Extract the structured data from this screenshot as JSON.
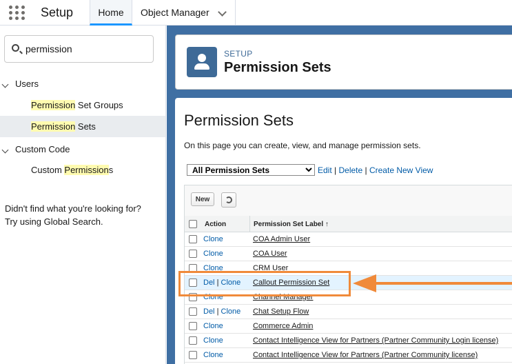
{
  "topbar": {
    "app_title": "Setup",
    "tabs": [
      {
        "label": "Home",
        "active": true
      },
      {
        "label": "Object Manager"
      }
    ]
  },
  "sidebar": {
    "search": {
      "value": "permission"
    },
    "sections": [
      {
        "label": "Users",
        "items": [
          {
            "pre": "",
            "match": "Permission",
            "post": " Set Groups"
          },
          {
            "pre": "",
            "match": "Permission",
            "post": " Sets",
            "selected": true
          }
        ]
      },
      {
        "label": "Custom Code",
        "items": [
          {
            "pre": "Custom ",
            "match": "Permission",
            "post": "s"
          }
        ]
      }
    ],
    "help_line1": "Didn't find what you're looking for?",
    "help_line2": "Try using Global Search."
  },
  "header": {
    "eyebrow": "SETUP",
    "title": "Permission Sets"
  },
  "content": {
    "title": "Permission Sets",
    "description": "On this page you can create, view, and manage permission sets.",
    "view_select": "All Permission Sets",
    "view_links": {
      "edit": "Edit",
      "delete": "Delete",
      "create": "Create New View"
    },
    "buttons": {
      "new": "New"
    },
    "columns": {
      "action": "Action",
      "label": "Permission Set Label ↑"
    },
    "rows": [
      {
        "actions": "Clone",
        "label": "COA Admin User"
      },
      {
        "actions": "Clone",
        "label": "COA User"
      },
      {
        "actions": "Clone",
        "label": "CRM User"
      },
      {
        "actions": "Del | Clone",
        "label": "Callout Permission Set",
        "highlighted": true
      },
      {
        "actions": "Clone",
        "label": "Channel Manager"
      },
      {
        "actions": "Del | Clone",
        "label": "Chat Setup Flow"
      },
      {
        "actions": "Clone",
        "label": "Commerce Admin"
      },
      {
        "actions": "Clone",
        "label": "Contact Intelligence View for Partners (Partner Community Login license)"
      },
      {
        "actions": "Clone",
        "label": "Contact Intelligence View for Partners (Partner Community license)"
      }
    ]
  },
  "colors": {
    "accent": "#f08a3a",
    "link": "#015ba7",
    "header_icon": "#3e6a97",
    "highlight": "#fffbb0"
  }
}
